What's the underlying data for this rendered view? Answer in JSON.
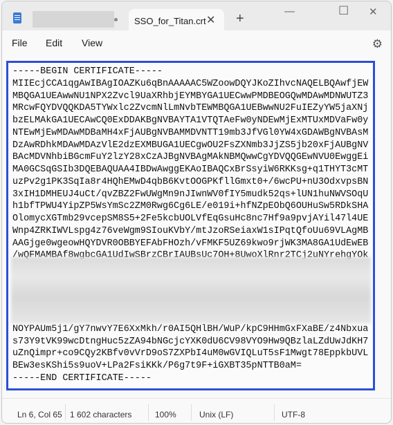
{
  "window": {
    "tab_title": "SSO_for_Titan.crt",
    "app_icon": "notepad-icon"
  },
  "menu": [
    "File",
    "Edit",
    "View"
  ],
  "editor": {
    "lines": [
      "-----BEGIN CERTIFICATE-----",
      "MIIEcjCCA1qgAwIBAgIOAZKu6qBnAAAAAC5WZoowDQYJKoZIhvcNAQELBQAwfjEW",
      "MBQGA1UEAwwNU1NPX2Zvcl9UaXRhbjEYMBYGA1UECwwPMDBEOGQwMDAwMDNWUTZ3",
      "MRcwFQYDVQQKDA5TYWxlc2ZvcmNlLmNvbTEWMBQGA1UEBwwNU2FuIEZyYW5jaXNj",
      "bzELMAkGA1UECAwCQ0ExDDAKBgNVBAYTA1VTQTAeFw0yNDEwMjExMTUxMDVaFw0y",
      "NTEwMjEwMDAwMDBaMH4xFjAUBgNVBAMMDVNTT19mb3JfVGl0YW4xGDAWBgNVBAsM",
      "DzAwRDhkMDAwMDAzVlE2dzEXMBUGA1UECgwOU2FsZXNmb3JjZS5jb20xFjAUBgNV",
      "BAcMDVNhbiBGcmFuY2lzY28xCzAJBgNVBAgMAkNBMQwwCgYDVQQGEwNVU0EwggEi",
      "MA0GCSqGSIb3DQEBAQUAA4IBDwAwggEKAoIBAQCxBrSsyiW6RKKsg+q1THYT3cMT",
      "uzPv2g1PK3SqIa8r4HQhEMwD4qbB6KvtOOGPKfllGmxt0+/6wcPU+nU3OdxvpsBN",
      "3xIH1DMHEUJ4uCt/qvZBZ2FwUWgMn9nJIwnWV0fIY5mudk52qs+lUN1huNWVSOqU",
      "h1bfTPWU4YipZP5WsYmSc2ZM0Rwg6Cg6LE/e019i+hfNZpEObQ6OUHuSw5RDkSHA",
      "OlomycXGTmb29vcepSM8S5+2Fe5kcbUOLVfEqGsuHc8nc7Hf9a9pvjAYil47l4UE",
      "Wnp4ZRKIWVLspg4z76veWgm9SIouKVbY/mtJzoRSeiaxW1sIPqtQfoUu69VLAgMB",
      "AAGjge0wgeowHQYDVR0OBBYEFAbFHOzh/vFMKF5UZ69kwo9rjWK3MA8GA1UdEwEB",
      "/wQFMAMBAf8wgbcGA1UdIwSBrzCBrIAUBsUc7OH+8UwoXlRnr2TCj2uNYrehgYOk",
      "",
      "",
      "",
      "",
      "",
      "NOYPAUm5j1/gY7nwvY7E6XxMkh/r0AI5QHlBH/WuP/kpC9HHmGxFXaBE/z4Nbxua",
      "s73Y9tVK99wcDtngHuc5zZA94bNGcjcYXK0dU6CV98VYO9Hw9QBzlaLZdUwJdKH7",
      "uZnQimpr+co9CQy2KBfv0vVrD9oS7ZXPbI4uM0wGVIQLuT5sF1Mwgt78EppkbUVL",
      "BEw3esKShi5s9uoV+LPa2FsiKKk/P6g7t9F+iGXBT35pNTTB0aM=",
      "-----END CERTIFICATE-----"
    ]
  },
  "status": {
    "position": "Ln 6, Col 65",
    "characters": "1 602 characters",
    "zoom": "100%",
    "line_ending": "Unix (LF)",
    "encoding": "UTF-8"
  },
  "accent": "#2b4fd8"
}
